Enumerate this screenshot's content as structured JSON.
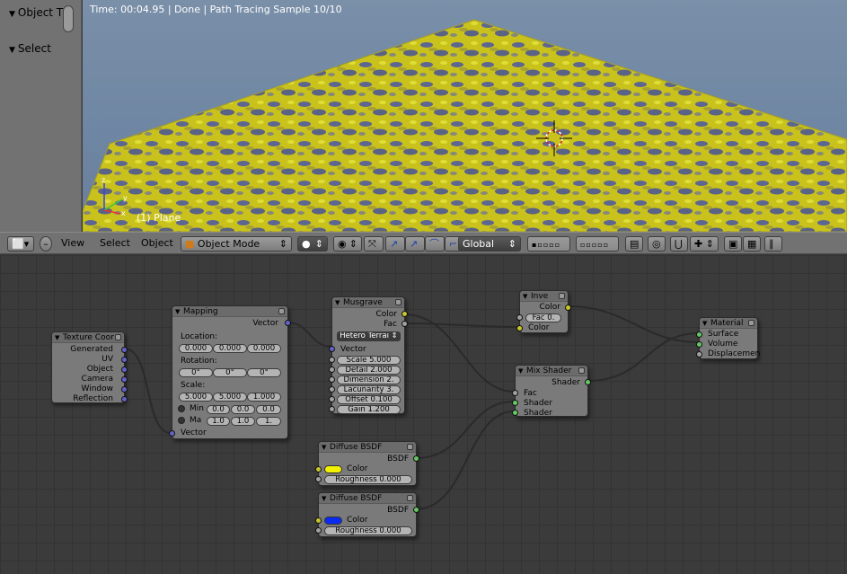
{
  "shelf": {
    "panel1": "Object T",
    "panel2": "Select"
  },
  "viewport": {
    "status": "Time: 00:04.95 | Done | Path Tracing Sample 10/10",
    "object_label": "(1) Plane"
  },
  "header3d": {
    "view": "View",
    "select": "Select",
    "object": "Object",
    "mode": "Object Mode",
    "orientation": "Global"
  },
  "nodes": {
    "texcoord": {
      "title": "Texture Coor",
      "outputs": [
        "Generated",
        "UV",
        "Object",
        "Camera",
        "Window",
        "Reflection"
      ]
    },
    "mapping": {
      "title": "Mapping",
      "output": "Vector",
      "location_label": "Location:",
      "location": [
        "0.000",
        "0.000",
        "0.000"
      ],
      "rotation_label": "Rotation:",
      "rotation": [
        "0°",
        "0°",
        "0°"
      ],
      "scale_label": "Scale:",
      "scale": [
        "5.000",
        "5.000",
        "1.000"
      ],
      "min_label": "Min",
      "min": [
        "0.0",
        "0.0",
        "0.0"
      ],
      "max_label": "Ma",
      "max": [
        "1.0",
        "1.0",
        "1."
      ],
      "input": "Vector"
    },
    "musgrave": {
      "title": "Musgrave",
      "outputs": [
        "Color",
        "Fac"
      ],
      "type": "Hetero Terrai",
      "input": "Vector",
      "fields": [
        "Scale 5.000",
        "Detail 2.000",
        "Dimension 2.",
        "Lacunarity 3.",
        "Offset 0.100",
        "Gain 1.200"
      ]
    },
    "invert": {
      "title": "Inve",
      "output": "Color",
      "fac": "Fac 0.",
      "input": "Color"
    },
    "mix": {
      "title": "Mix Shader",
      "output": "Shader",
      "inputs": [
        "Fac",
        "Shader",
        "Shader"
      ]
    },
    "diffuse1": {
      "title": "Diffuse BSDF",
      "output": "BSDF",
      "color_label": "Color",
      "roughness": "Roughness 0.000",
      "swatch": "#f2f200"
    },
    "diffuse2": {
      "title": "Diffuse BSDF",
      "output": "BSDF",
      "color_label": "Color",
      "roughness": "Roughness 0.000",
      "swatch": "#0a2af2"
    },
    "material": {
      "title": "Material",
      "inputs": [
        "Surface",
        "Volume",
        "Displacemen"
      ]
    }
  }
}
